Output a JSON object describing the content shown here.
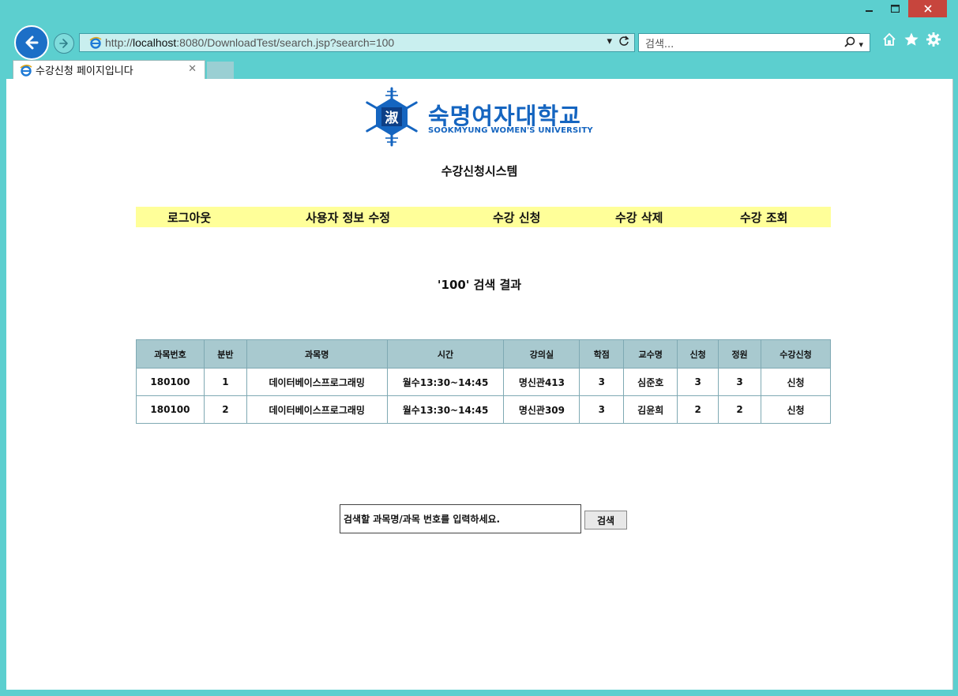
{
  "browser": {
    "address_prefix": "http://",
    "address_host": "localhost",
    "address_rest": ":8080/DownloadTest/search.jsp?search=100",
    "search_placeholder": "검색...",
    "tab_title": "수강신청 페이지입니다"
  },
  "page": {
    "logo_korean": "숙명여자대학교",
    "logo_english": "SOOKMYUNG WOMEN'S UNIVERSITY",
    "logo_seal": "淑",
    "system_title": "수강신청시스템",
    "menu": {
      "logout": "로그아웃",
      "edit_user": "사용자 정보 수정",
      "enroll": "수강 신청",
      "delete": "수강 삭제",
      "view": "수강 조회"
    },
    "result_title": "'100' 검색 결과",
    "table": {
      "headers": [
        "과목번호",
        "분반",
        "과목명",
        "시간",
        "강의실",
        "학점",
        "교수명",
        "신청",
        "정원",
        "수강신청"
      ],
      "rows": [
        [
          "180100",
          "1",
          "데이터베이스프로그래밍",
          "월수13:30~14:45",
          "명신관413",
          "3",
          "심준호",
          "3",
          "3",
          "신청"
        ],
        [
          "180100",
          "2",
          "데이터베이스프로그래밍",
          "월수13:30~14:45",
          "명신관309",
          "3",
          "김윤희",
          "2",
          "2",
          "신청"
        ]
      ]
    },
    "search": {
      "placeholder": "검색할 과목명/과목 번호를 입력하세요.",
      "button": "검색"
    }
  },
  "colors": {
    "chrome": "#5ccfcf",
    "menu_bg": "#ffff99",
    "table_header_bg": "#a8c9cf",
    "logo_blue": "#1565c0",
    "close_button": "#c7453d"
  }
}
